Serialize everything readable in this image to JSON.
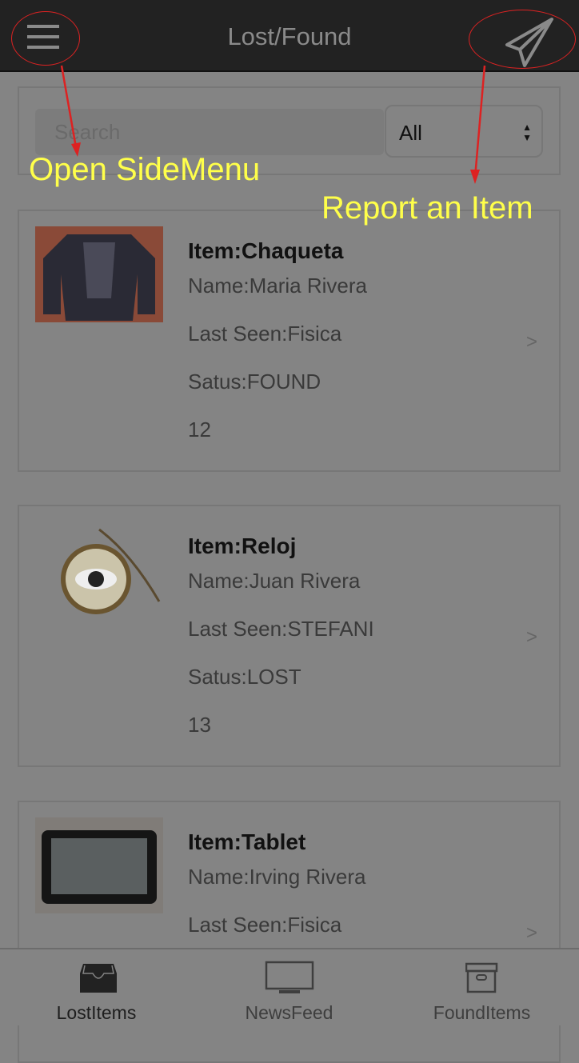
{
  "header": {
    "title": "Lost/Found",
    "menu_icon": "hamburger-icon",
    "report_icon": "paper-plane-icon"
  },
  "search": {
    "placeholder": "Search",
    "filter_value": "All"
  },
  "annotations": {
    "side_menu": "Open SideMenu",
    "report": "Report an Item",
    "color": "#ffff4a",
    "arrow_color": "#dd2222"
  },
  "items": [
    {
      "title": "Item:Chaqueta",
      "name": "Name:Maria Rivera",
      "last_seen": "Last Seen:Fisica",
      "status": "Satus:FOUND",
      "id": "12",
      "chevron": ">"
    },
    {
      "title": "Item:Reloj",
      "name": "Name:Juan Rivera",
      "last_seen": "Last Seen:STEFANI",
      "status": "Satus:LOST",
      "id": "13",
      "chevron": ">"
    },
    {
      "title": "Item:Tablet",
      "name": "Name:Irving Rivera",
      "last_seen": "Last Seen:Fisica",
      "chevron": ">"
    }
  ],
  "tabs": [
    {
      "label": "LostItems",
      "icon": "inbox-icon",
      "active": true
    },
    {
      "label": "NewsFeed",
      "icon": "monitor-icon"
    },
    {
      "label": "FoundItems",
      "icon": "archive-box-icon"
    }
  ]
}
